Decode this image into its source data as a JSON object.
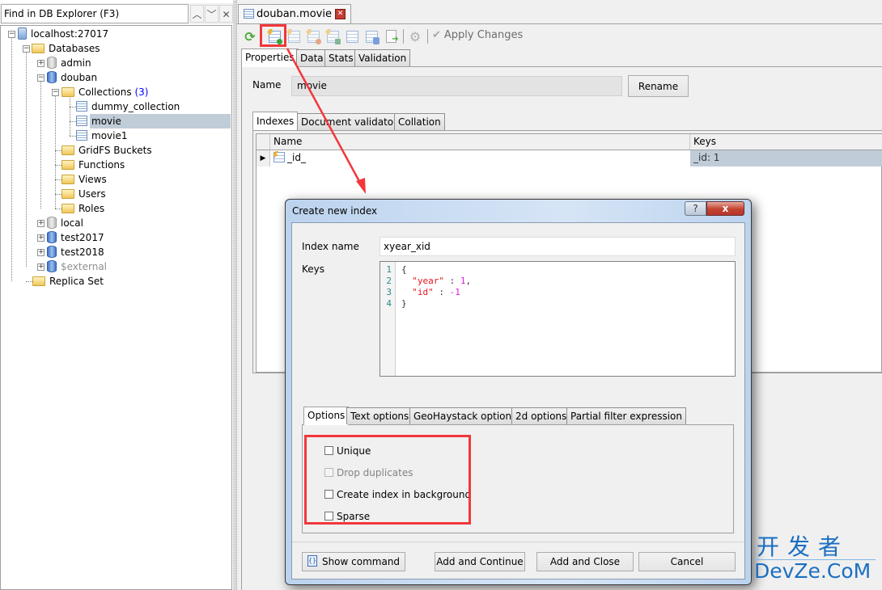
{
  "explorer": {
    "find_placeholder": "Find in DB Explorer (F3)",
    "find_prev_icon": "chevron-up-icon",
    "find_next_icon": "chevron-down-icon",
    "find_close_icon": "close-icon",
    "tree": {
      "server": "localhost:27017",
      "databases_label": "Databases",
      "dbs": [
        {
          "name": "admin",
          "expanded": false,
          "icon": "database-gray-icon"
        },
        {
          "name": "douban",
          "expanded": true,
          "icon": "database-blue-icon"
        },
        {
          "name": "local",
          "expanded": false,
          "icon": "database-gray-icon"
        },
        {
          "name": "test2017",
          "expanded": false,
          "icon": "database-blue-icon"
        },
        {
          "name": "test2018",
          "expanded": false,
          "icon": "database-blue-icon"
        },
        {
          "name": "$external",
          "expanded": false,
          "icon": "database-blue-icon",
          "muted": true
        }
      ],
      "collections_label": "Collections",
      "collections_count": "(3)",
      "collections": [
        "dummy_collection",
        "movie",
        "movie1"
      ],
      "selected_collection": "movie",
      "douban_folders": [
        "GridFS Buckets",
        "Functions",
        "Views",
        "Users",
        "Roles"
      ],
      "replica_set": "Replica Set"
    }
  },
  "document": {
    "tab_title": "douban.movie",
    "toolbar": {
      "items": [
        "refresh-icon",
        "add-index-icon",
        "edit-index-icon",
        "drop-index-icon",
        "hide-index-icon",
        "reindex-icon",
        "compact-icon",
        "export-icon",
        "settings-gear-icon"
      ],
      "apply_changes": "Apply Changes"
    },
    "tabs": [
      "Properties",
      "Data",
      "Stats",
      "Validation"
    ],
    "active_tab": "Properties",
    "name_label": "Name",
    "name_value": "movie",
    "rename_button": "Rename",
    "subtabs": [
      "Indexes",
      "Document validator",
      "Collation"
    ],
    "active_subtab": "Indexes",
    "indexes": {
      "columns": [
        "Name",
        "Keys"
      ],
      "rows": [
        {
          "name": "_id_",
          "keys": "_id: 1"
        }
      ]
    }
  },
  "dialog": {
    "title": "Create new index",
    "help": "?",
    "close": "x",
    "index_name_label": "Index name",
    "index_name_value": "xyear_xid",
    "keys_label": "Keys",
    "keys_code": {
      "line_numbers": [
        "1",
        "2",
        "3",
        "4"
      ],
      "lines": [
        {
          "open": "{"
        },
        {
          "key": "\"year\"",
          "sep": " : ",
          "value": "1",
          "trail": ","
        },
        {
          "key": "\"id\"",
          "sep": " : ",
          "value": "-1",
          "trail": ""
        },
        {
          "close": "}"
        }
      ]
    },
    "option_tabs": [
      "Options",
      "Text options",
      "GeoHaystack options",
      "2d options",
      "Partial filter expression"
    ],
    "active_option_tab": "Options",
    "options": [
      {
        "label": "Unique",
        "checked": false,
        "disabled": false
      },
      {
        "label": "Drop duplicates",
        "checked": false,
        "disabled": true
      },
      {
        "label": "Create index in background",
        "checked": false,
        "disabled": false
      },
      {
        "label": "Sparse",
        "checked": false,
        "disabled": false
      }
    ],
    "buttons": {
      "show_command": "Show command",
      "add_continue": "Add and Continue",
      "add_close": "Add and Close",
      "cancel": "Cancel"
    }
  },
  "annotation": {
    "highlight_color": "#f2373c"
  },
  "watermark": {
    "line1": "开发者",
    "line2": "DevZe.CoM"
  }
}
